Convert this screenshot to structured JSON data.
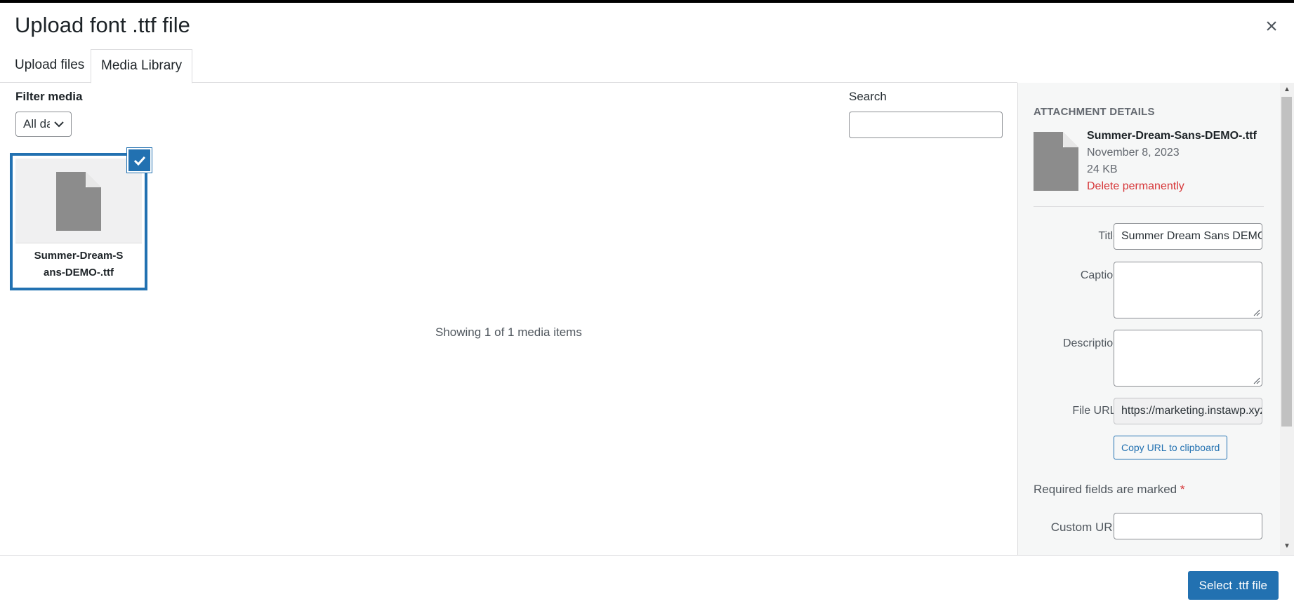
{
  "modal": {
    "title": "Upload font .ttf file",
    "close_icon": "close-icon"
  },
  "tabs": [
    {
      "label": "Upload files"
    },
    {
      "label": "Media Library",
      "active": true
    }
  ],
  "filter": {
    "label": "Filter media",
    "selected": "All dates"
  },
  "search": {
    "label": "Search",
    "value": ""
  },
  "grid": {
    "items": [
      {
        "filename": "Summer-Dream-Sans-DEMO-.ttf",
        "selected": true,
        "icon": "document-icon"
      }
    ],
    "status": "Showing 1 of 1 media items"
  },
  "details": {
    "heading": "ATTACHMENT DETAILS",
    "filename": "Summer-Dream-Sans-DEMO-.ttf",
    "date": "November 8, 2023",
    "size": "24 KB",
    "delete_label": "Delete permanently",
    "title_label": "Title",
    "title_value": "Summer Dream Sans DEMO",
    "caption_label": "Caption",
    "caption_value": "",
    "description_label": "Description",
    "description_value": "",
    "file_url_label": "File URL:",
    "file_url_value": "https://marketing.instawp.xyz",
    "copy_label": "Copy URL to clipboard",
    "required_text": "Required fields are marked",
    "required_star": "*",
    "custom_url_label": "Custom URL",
    "custom_url_value": ""
  },
  "footer": {
    "select_label": "Select .ttf file"
  },
  "colors": {
    "primary": "#2271b1",
    "danger": "#d63638",
    "sidebar_bg": "#f6f7f7"
  }
}
